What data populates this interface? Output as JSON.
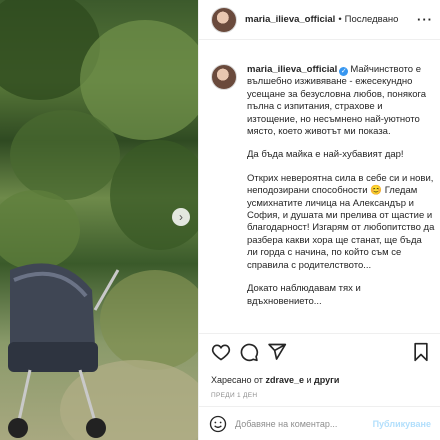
{
  "header": {
    "username": "maria_ilieva_official",
    "separator": "•",
    "follow_status": "Последвано",
    "more_icon": "more-icon"
  },
  "caption": {
    "username": "maria_ilieva_official",
    "paragraphs": [
      "Майчинството е вълшебно изживяване - ежесекундно усещане за безусловна любов, понякога пълна с изпитания, страхове и изтощение, но несъмнено най-уютното място, което животът ми показа.",
      "Да бъда майка е най-хубавият дар!",
      "Открих невероятна сила в себе си и нови, неподозирани способности 😊 Гледам усмихнатите личица на Александър и София, и душата ми прелива от щастие и благодарност! Изгарям от любопитство да разбера какви хора ще станат, ще бъда ли горда с начина, по който съм се справила с родителството...",
      "Докато наблюдавам тях и вдъхновението..."
    ]
  },
  "likes": {
    "prefix": "Харесано от",
    "user": "zdrave_e",
    "conjunction": "и",
    "others": "други"
  },
  "timestamp": "ПРЕДИ 1 ДЕН",
  "comment": {
    "placeholder": "Добавяне на коментар...",
    "publish_label": "Публикуване"
  },
  "colors": {
    "verified": "#3897f0",
    "publish_disabled": "#b2dffc",
    "muted": "#8e8e8e"
  }
}
